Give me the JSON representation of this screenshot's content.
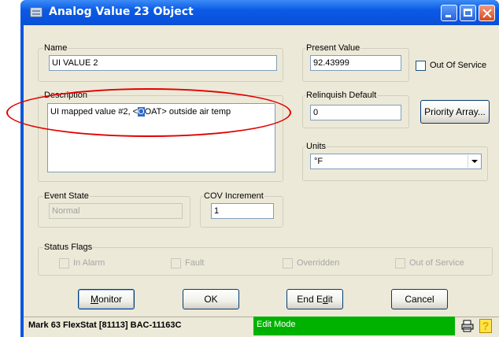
{
  "window": {
    "title": "Analog Value 23 Object",
    "controls": {
      "minimize": "minimize",
      "maximize": "maximize",
      "close": "close"
    }
  },
  "name": {
    "label": "Name",
    "value": "UI VALUE 2"
  },
  "present_value": {
    "label": "Present Value",
    "value": "92.43999"
  },
  "out_of_service": {
    "label": "Out Of Service",
    "checked": false
  },
  "description": {
    "label": "Description",
    "value_before": "UI mapped value #2, <",
    "value_selected": "O",
    "value_after": "OAT> outside air temp"
  },
  "relinquish_default": {
    "label": "Relinquish Default",
    "value": "0"
  },
  "priority_array_button": "Priority Array...",
  "units": {
    "label": "Units",
    "selected": "°F"
  },
  "event_state": {
    "label": "Event State",
    "value": "Normal"
  },
  "cov_increment": {
    "label": "COV Increment",
    "value": "1"
  },
  "status_flags": {
    "label": "Status Flags",
    "flags": [
      "In Alarm",
      "Fault",
      "Overridden",
      "Out of Service"
    ]
  },
  "buttons": {
    "monitor": {
      "mnemonic": "M",
      "rest": "onitor"
    },
    "ok": "OK",
    "end_edit": {
      "before": "End E",
      "mnemonic": "d",
      "after": "it"
    },
    "cancel": "Cancel"
  },
  "statusbar": {
    "device": "Mark 63 FlexStat [81113] BAC-11163C",
    "mode": "Edit Mode",
    "icons": [
      "printer-icon",
      "help-icon"
    ]
  },
  "colors": {
    "titlebar": "#0a55e0",
    "dialog": "#ece9d8",
    "edit_mode": "#00b200",
    "annotation": "#e30000"
  }
}
